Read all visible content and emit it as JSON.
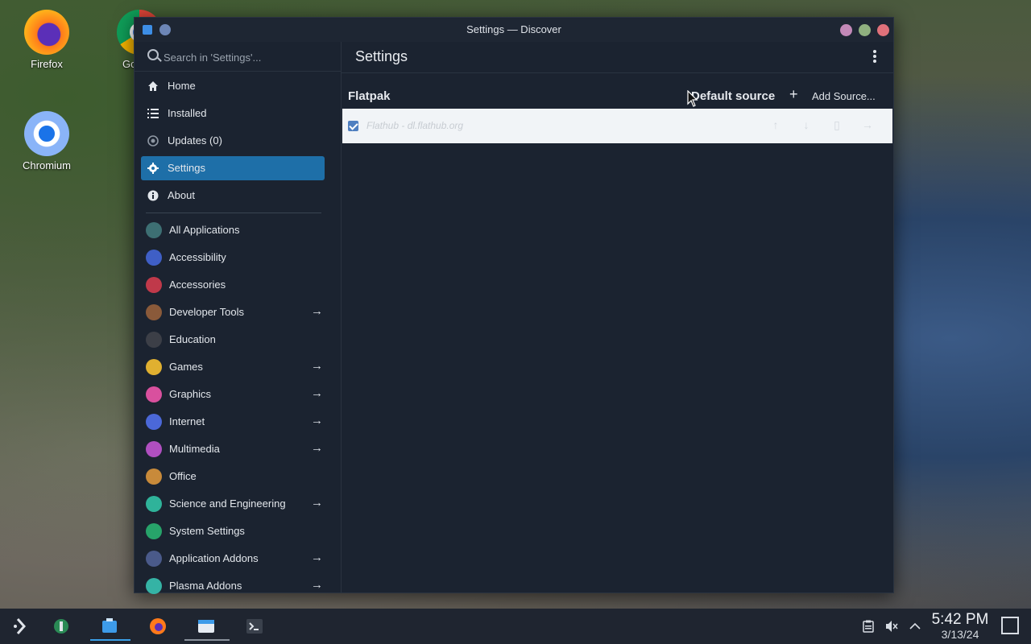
{
  "desktop": {
    "icons": [
      {
        "label": "Firefox"
      },
      {
        "label": "Google"
      },
      {
        "label": "Chromium"
      }
    ]
  },
  "window": {
    "title": "Settings — Discover",
    "search_placeholder": "Search in 'Settings'...",
    "nav": [
      {
        "label": "Home",
        "icon": "home-icon"
      },
      {
        "label": "Installed",
        "icon": "list-icon"
      },
      {
        "label": "Updates (0)",
        "icon": "updates-icon"
      },
      {
        "label": "Settings",
        "icon": "gear-icon"
      },
      {
        "label": "About",
        "icon": "info-icon"
      }
    ],
    "categories": [
      {
        "label": "All Applications",
        "color": "#3d6f73",
        "arrow": false
      },
      {
        "label": "Accessibility",
        "color": "#3f5fc6",
        "arrow": false
      },
      {
        "label": "Accessories",
        "color": "#c0394a",
        "arrow": false
      },
      {
        "label": "Developer Tools",
        "color": "#8a5a3a",
        "arrow": true
      },
      {
        "label": "Education",
        "color": "#3c3f47",
        "arrow": false
      },
      {
        "label": "Games",
        "color": "#e0b030",
        "arrow": true
      },
      {
        "label": "Graphics",
        "color": "#d9509e",
        "arrow": true
      },
      {
        "label": "Internet",
        "color": "#4b68d8",
        "arrow": true
      },
      {
        "label": "Multimedia",
        "color": "#b04fc0",
        "arrow": true
      },
      {
        "label": "Office",
        "color": "#c88a3a",
        "arrow": false
      },
      {
        "label": "Science and Engineering",
        "color": "#2fb39a",
        "arrow": true
      },
      {
        "label": "System Settings",
        "color": "#27a36a",
        "arrow": false
      },
      {
        "label": "Application Addons",
        "color": "#4a5a8a",
        "arrow": true
      },
      {
        "label": "Plasma Addons",
        "color": "#35b3a5",
        "arrow": true
      }
    ],
    "arrow_glyph": "→",
    "header_title": "Settings",
    "section_title": "Flatpak",
    "default_source": "Default source",
    "plus": "+",
    "add_source": "Add Source...",
    "source_row": {
      "name": "Flathub - dl.flathub.org",
      "checked": true
    }
  },
  "taskbar": {
    "time": "5:42 PM",
    "date": "3/13/24"
  },
  "colors": {
    "accent": "#1e6fa8",
    "window_bg": "#1b2330",
    "taskbar_bg": "#1f2530"
  }
}
